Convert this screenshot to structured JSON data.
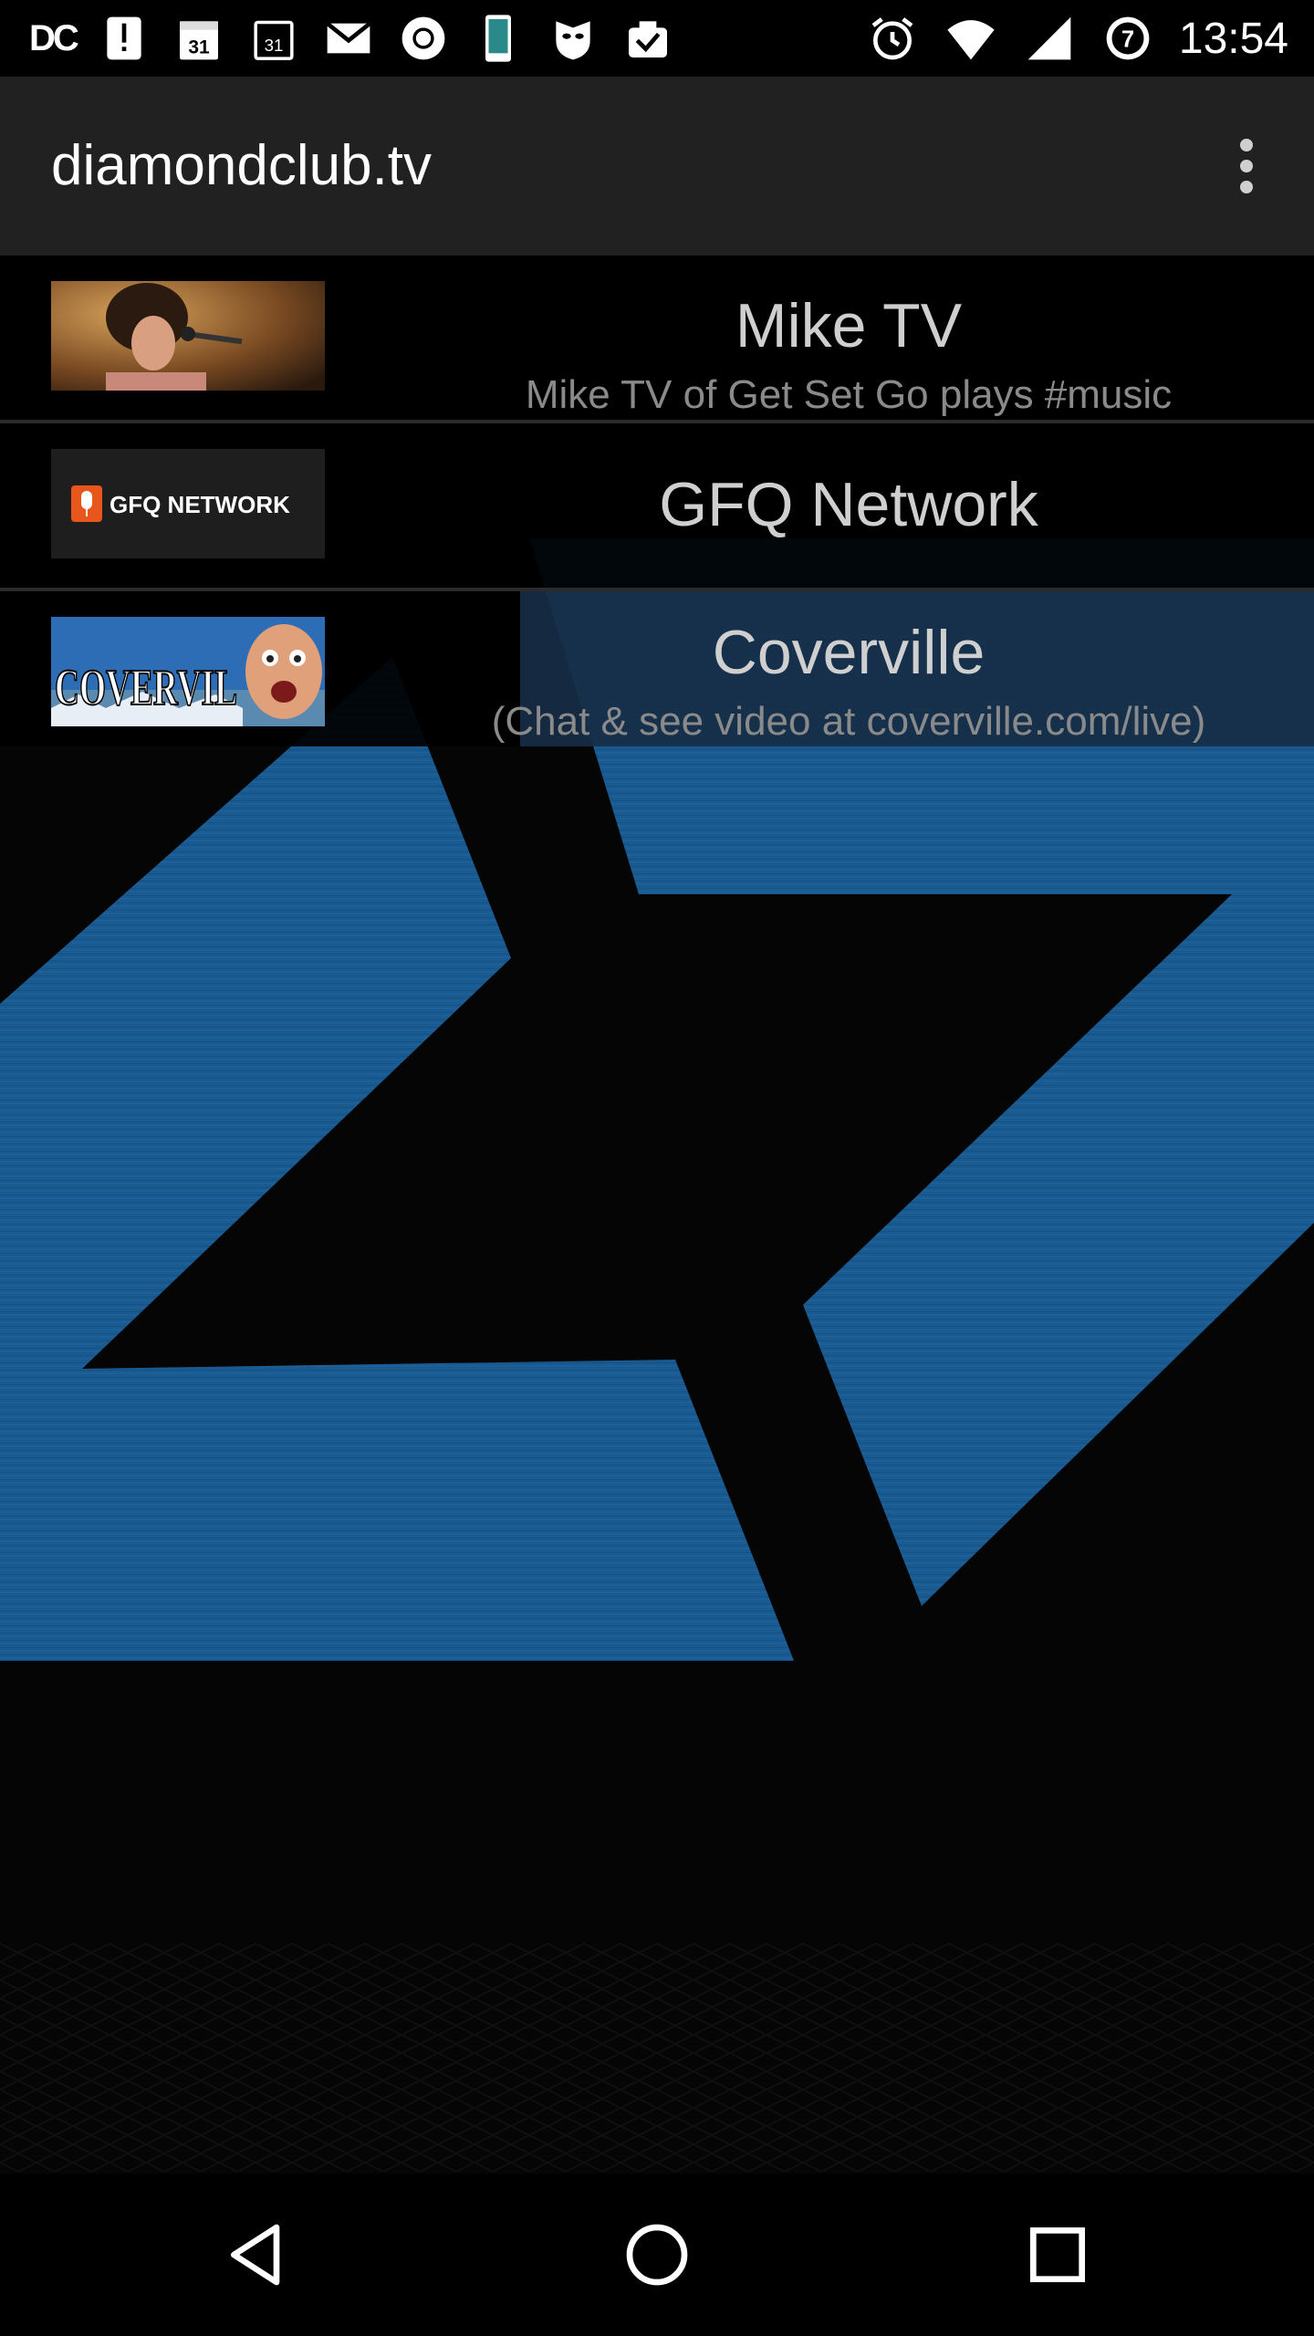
{
  "status_bar": {
    "carrier_text": "DC",
    "time": "13:54",
    "notification_badge": "7",
    "left_icons": [
      "dc-logo",
      "alert-icon",
      "calendar-icon",
      "calendar-icon",
      "gmail-icon",
      "chrome-icon",
      "phone-icon",
      "incognito-icon",
      "task-icon"
    ],
    "right_icons": [
      "alarm-icon",
      "wifi-icon",
      "signal-icon",
      "badge-7-icon"
    ]
  },
  "app_bar": {
    "title": "diamondclub.tv",
    "overflow_icon": "more-vert-icon"
  },
  "channels": [
    {
      "title": "Mike TV",
      "subtitle": "Mike TV of Get Set Go plays #music",
      "thumb_icon": "singer-photo"
    },
    {
      "title": "GFQ Network",
      "subtitle": "",
      "thumb_icon": "gfq-network-logo",
      "thumb_text": "GFQ NETWORK"
    },
    {
      "title": "Coverville",
      "subtitle": "(Chat & see video at coverville.com/live)",
      "thumb_icon": "coverville-logo",
      "thumb_text": "COVERVIL"
    }
  ],
  "nav_bar": {
    "back_icon": "back-triangle-icon",
    "home_icon": "home-circle-icon",
    "recents_icon": "recents-square-icon"
  },
  "colors": {
    "app_bar": "#212121",
    "logo_blue": "#1a5a92",
    "highlight": "#162d46"
  }
}
